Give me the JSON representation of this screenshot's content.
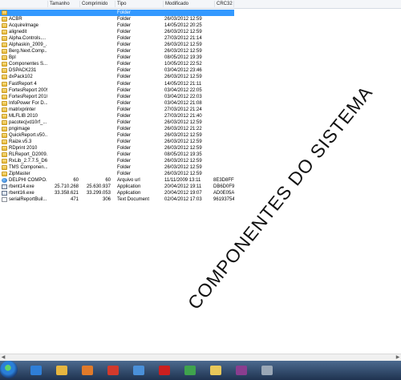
{
  "columns": {
    "name": "",
    "size": "Tamanho",
    "compressed": "Comprimido",
    "type": "Tipo",
    "modified": "Modificado",
    "crc": "CRC32"
  },
  "rows": [
    {
      "icon": "folder",
      "name": "",
      "size": "",
      "comp": "",
      "type": "Folder",
      "mod": "",
      "crc": "",
      "selected": true
    },
    {
      "icon": "folder",
      "name": "ACBR",
      "size": "",
      "comp": "",
      "type": "Folder",
      "mod": "26/03/2012 12:59",
      "crc": ""
    },
    {
      "icon": "folder",
      "name": "AcquireImage",
      "size": "",
      "comp": "",
      "type": "Folder",
      "mod": "14/05/2012 20:25",
      "crc": ""
    },
    {
      "icon": "folder",
      "name": "alignedit",
      "size": "",
      "comp": "",
      "type": "Folder",
      "mod": "26/03/2012 12:59",
      "crc": ""
    },
    {
      "icon": "folder",
      "name": "Alpha.Controls....",
      "size": "",
      "comp": "",
      "type": "Folder",
      "mod": "27/03/2012 21:14",
      "crc": ""
    },
    {
      "icon": "folder",
      "name": "Alphaskin_2009_...",
      "size": "",
      "comp": "",
      "type": "Folder",
      "mod": "26/03/2012 12:59",
      "crc": ""
    },
    {
      "icon": "folder",
      "name": "Berg.Next.Comp...",
      "size": "",
      "comp": "",
      "type": "Folder",
      "mod": "26/03/2012 12:59",
      "crc": ""
    },
    {
      "icon": "folder",
      "name": "Bpl",
      "size": "",
      "comp": "",
      "type": "Folder",
      "mod": "08/05/2012 19:39",
      "crc": ""
    },
    {
      "icon": "folder",
      "name": "Componentes S...",
      "size": "",
      "comp": "",
      "type": "Folder",
      "mod": "10/05/2012 22:52",
      "crc": ""
    },
    {
      "icon": "folder",
      "name": "DSPACK231",
      "size": "",
      "comp": "",
      "type": "Folder",
      "mod": "03/04/2012 23:46",
      "crc": ""
    },
    {
      "icon": "folder",
      "name": "dxPack102",
      "size": "",
      "comp": "",
      "type": "Folder",
      "mod": "26/03/2012 12:59",
      "crc": ""
    },
    {
      "icon": "folder",
      "name": "FastReport 4",
      "size": "",
      "comp": "",
      "type": "Folder",
      "mod": "14/05/2012 21:11",
      "crc": ""
    },
    {
      "icon": "folder",
      "name": "FortesReport 2009",
      "size": "",
      "comp": "",
      "type": "Folder",
      "mod": "03/04/2012 22:05",
      "crc": ""
    },
    {
      "icon": "folder",
      "name": "FortesReport 2010",
      "size": "",
      "comp": "",
      "type": "Folder",
      "mod": "03/04/2012 22:03",
      "crc": ""
    },
    {
      "icon": "folder",
      "name": "InfoPower For D...",
      "size": "",
      "comp": "",
      "type": "Folder",
      "mod": "03/04/2012 21:08",
      "crc": ""
    },
    {
      "icon": "folder",
      "name": "matrixprinter",
      "size": "",
      "comp": "",
      "type": "Folder",
      "mod": "27/03/2012 21:24",
      "crc": ""
    },
    {
      "icon": "folder",
      "name": "MLFLIB 2010",
      "size": "",
      "comp": "",
      "type": "Folder",
      "mod": "27/03/2012 21:40",
      "crc": ""
    },
    {
      "icon": "folder",
      "name": "pacotecjvd10rf_...",
      "size": "",
      "comp": "",
      "type": "Folder",
      "mod": "26/03/2012 12:59",
      "crc": ""
    },
    {
      "icon": "folder",
      "name": "pngimage",
      "size": "",
      "comp": "",
      "type": "Folder",
      "mod": "26/03/2012 21:22",
      "crc": ""
    },
    {
      "icon": "folder",
      "name": "QuickReport.v50...",
      "size": "",
      "comp": "",
      "type": "Folder",
      "mod": "26/03/2012 12:59",
      "crc": ""
    },
    {
      "icon": "folder",
      "name": "Raize.v5.3",
      "size": "",
      "comp": "",
      "type": "Folder",
      "mod": "26/03/2012 12:59",
      "crc": ""
    },
    {
      "icon": "folder",
      "name": "RDprint 2010",
      "size": "",
      "comp": "",
      "type": "Folder",
      "mod": "26/03/2012 12:59",
      "crc": ""
    },
    {
      "icon": "folder",
      "name": "RLReport_D2009...",
      "size": "",
      "comp": "",
      "type": "Folder",
      "mod": "08/05/2012 19:35",
      "crc": ""
    },
    {
      "icon": "folder",
      "name": "RxLib_2.7.7.5_D6...",
      "size": "",
      "comp": "",
      "type": "Folder",
      "mod": "26/03/2012 12:59",
      "crc": ""
    },
    {
      "icon": "folder",
      "name": "TMS Componen...",
      "size": "",
      "comp": "",
      "type": "Folder",
      "mod": "26/03/2012 12:59",
      "crc": ""
    },
    {
      "icon": "folder",
      "name": "ZipMaster",
      "size": "",
      "comp": "",
      "type": "Folder",
      "mod": "26/03/2012 12:59",
      "crc": ""
    },
    {
      "icon": "url",
      "name": "DELPHI COMPO...",
      "size": "60",
      "comp": "60",
      "type": "Arquivo url",
      "mod": "11/11/2009 13:11",
      "crc": "8E3D8FF9"
    },
    {
      "icon": "exe",
      "name": "rbent14.exe",
      "size": "25.710.268",
      "comp": "25.630.937",
      "type": "Application",
      "mod": "20/04/2012 19:11",
      "crc": "DB6D0F94"
    },
    {
      "icon": "exe",
      "name": "rbent16.exe",
      "size": "33.358.621",
      "comp": "33.299.053",
      "type": "Application",
      "mod": "20/04/2012 19:07",
      "crc": "AD0E05AC"
    },
    {
      "icon": "file",
      "name": "serialReportBuil...",
      "size": "471",
      "comp": "306",
      "type": "Text Document",
      "mod": "02/04/2012 17:03",
      "crc": "96193754"
    }
  ],
  "overlay_text": "COMPONENTES    DO SISTEMA",
  "taskbar": [
    {
      "name": "ie-taskbar-icon",
      "color": "#2f7fd8"
    },
    {
      "name": "explorer-taskbar-icon",
      "color": "#e6b640"
    },
    {
      "name": "media-player-taskbar-icon",
      "color": "#e07a2a"
    },
    {
      "name": "app-red-taskbar-icon",
      "color": "#d33a2c"
    },
    {
      "name": "app-blue-taskbar-icon",
      "color": "#4a90d9"
    },
    {
      "name": "opera-taskbar-icon",
      "color": "#cc1f1f"
    },
    {
      "name": "chrome-taskbar-icon",
      "color": "#3fa34d"
    },
    {
      "name": "folder-taskbar-icon",
      "color": "#e8c85a"
    },
    {
      "name": "winrar-taskbar-icon",
      "color": "#8a3d8f"
    },
    {
      "name": "app-gray-taskbar-icon",
      "color": "#9aa7b6"
    }
  ]
}
